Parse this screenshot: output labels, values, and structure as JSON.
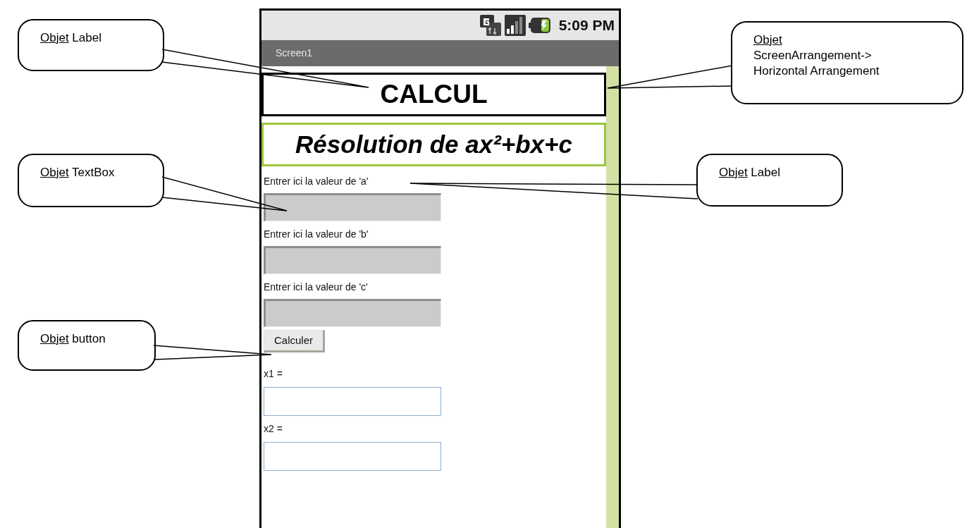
{
  "status_bar": {
    "time": "5:09 PM"
  },
  "title_bar": {
    "title": "Screen1"
  },
  "header": {
    "text": "CALCUL"
  },
  "subtitle": {
    "text": "Résolution de ax²+bx+c"
  },
  "inputs": [
    {
      "label": "Entrer ici la valeur de 'a'"
    },
    {
      "label": "Entrer ici la valeur de 'b'"
    },
    {
      "label": "Entrer ici la valeur de 'c'"
    }
  ],
  "button": {
    "label": "Calculer"
  },
  "outputs": [
    {
      "label": "x1 ="
    },
    {
      "label": "x2 ="
    }
  ],
  "callouts": [
    {
      "prefix": "Objet",
      "lines": [
        "Label"
      ]
    },
    {
      "prefix": "Objet",
      "lines": [
        "ScreenArrangement->",
        "Horizontal Arrangement"
      ]
    },
    {
      "prefix": "Objet",
      "lines": [
        "TextBox"
      ]
    },
    {
      "prefix": "Objet",
      "lines": [
        "Label"
      ]
    },
    {
      "prefix": "Objet",
      "lines": [
        "button"
      ]
    }
  ]
}
